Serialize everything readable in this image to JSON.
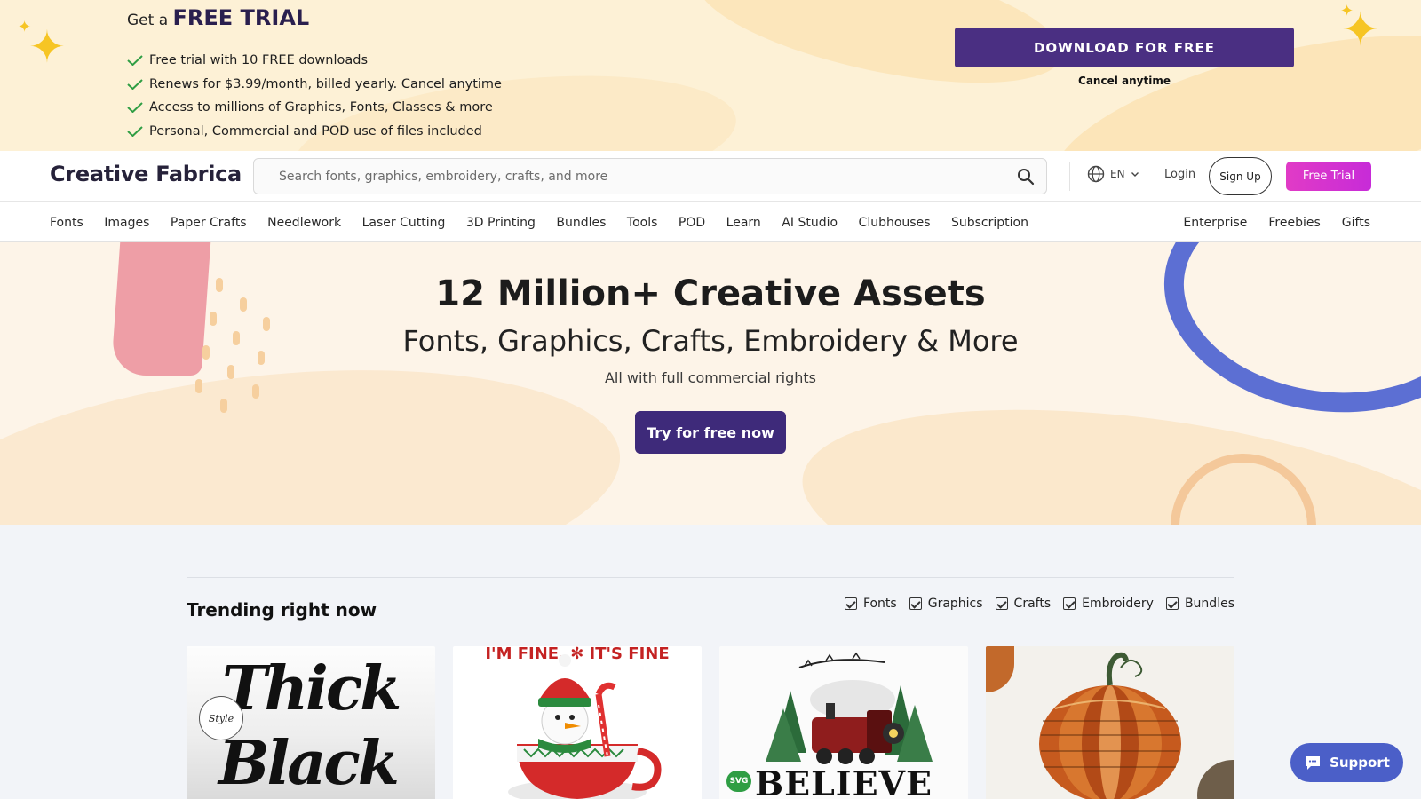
{
  "promo": {
    "heading_prefix": "Get a",
    "heading_strong": "FREE TRIAL",
    "benefits": [
      "Free trial with 10 FREE downloads",
      "Renews for $3.99/month, billed yearly. Cancel anytime",
      "Access to millions of Graphics, Fonts, Classes & more",
      "Personal, Commercial and POD use of files included"
    ],
    "cta_label": "DOWNLOAD FOR FREE",
    "cta_sub": "Cancel anytime",
    "accent_color": "#4a2f82"
  },
  "header": {
    "logo": "Creative Fabrica",
    "search_placeholder": "Search fonts, graphics, embroidery, crafts, and more",
    "language": "EN",
    "login": "Login",
    "signup": "Sign Up",
    "free_trial": "Free Trial"
  },
  "nav": {
    "left": [
      "Fonts",
      "Images",
      "Paper Crafts",
      "Needlework",
      "Laser Cutting",
      "3D Printing",
      "Bundles",
      "Tools",
      "POD",
      "Learn",
      "AI Studio",
      "Clubhouses",
      "Subscription"
    ],
    "right": [
      "Enterprise",
      "Freebies",
      "Gifts"
    ]
  },
  "hero": {
    "title": "12 Million+ Creative Assets",
    "subtitle": "Fonts, Graphics, Crafts, Embroidery & More",
    "note": "All with full commercial rights",
    "cta": "Try for free now"
  },
  "trending": {
    "title": "Trending right now",
    "filters": [
      "Fonts",
      "Graphics",
      "Crafts",
      "Embroidery",
      "Bundles"
    ],
    "cards": [
      {
        "text_top": "Thick",
        "text_bottom": "Black",
        "badge": "Style"
      },
      {
        "text_top": "I'M FINE, ✻ IT'S FINE"
      },
      {
        "text_bottom": "BELIEVE",
        "badge": "SVG"
      },
      {
        "icon": "pumpkin-books-icon"
      }
    ]
  },
  "support": {
    "label": "Support"
  }
}
